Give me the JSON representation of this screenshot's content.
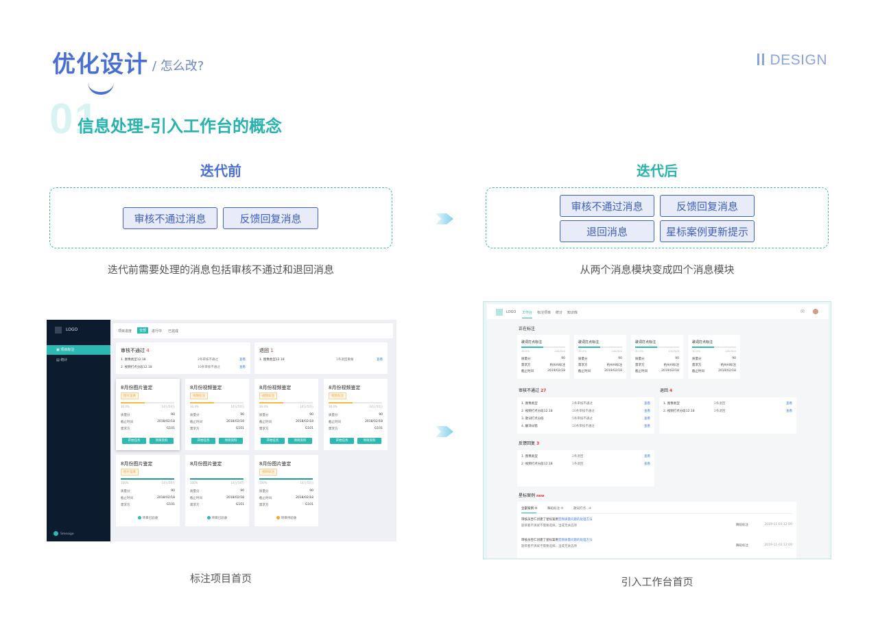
{
  "header": {
    "title": "优化设计",
    "subtitle": "/ 怎么改?",
    "brand": "DESIGN",
    "section_number": "01",
    "section_title": "信息处理-引入工作台的概念"
  },
  "before": {
    "label": "迭代前",
    "buttons": [
      "审核不通过消息",
      "反馈回复消息"
    ],
    "caption": "迭代前需要处理的消息包括审核不通过和退回消息",
    "screenshot_caption": "标注项目首页"
  },
  "after": {
    "label": "迭代后",
    "buttons": [
      "审核不通过消息",
      "反馈回复消息",
      "退回消息",
      "星标案例更新提示"
    ],
    "caption": "从两个消息模块变成四个消息模块",
    "screenshot_caption": "引入工作台首页"
  },
  "shotA": {
    "logo": "LOGO",
    "nav": [
      "项目标注",
      "统计"
    ],
    "user": "Smeaige",
    "tabs": [
      "项目进度",
      "全部",
      "进行中",
      "已完成"
    ],
    "reject_box": {
      "title": "审核不通过",
      "count": "4",
      "rows": [
        {
          "name": "1. 图像类型12.18",
          "msg": "2条审核不通过",
          "action": "查看"
        },
        {
          "name": "2. 视频打点分段12.18",
          "msg": "10条审核不通过",
          "action": "查看"
        }
      ]
    },
    "return_box": {
      "title": "退回",
      "count": "1",
      "rows": [
        {
          "name": "1. 图像类型12.18",
          "msg": "1条退回重做",
          "action": "查看"
        }
      ]
    },
    "cards": [
      {
        "title": "8月份图片鉴定",
        "tag": "图片鉴黄",
        "pct": "30.4%",
        "pcr": "14万/50万",
        "progress": 0.45,
        "q": "90",
        "d": "2018/02/18",
        "r": "G101",
        "state": "buttons"
      },
      {
        "title": "8月份视频鉴定",
        "tag": "视频标注",
        "pct": "30.4%",
        "pcr": "14万/50万",
        "progress": 0.45,
        "q": "90",
        "d": "2018/02/18",
        "r": "G101",
        "state": "buttons"
      },
      {
        "title": "8月份视频鉴定",
        "tag": "视频标注",
        "pct": "30.4%",
        "pcr": "14万/50万",
        "progress": 0.45,
        "q": "90",
        "d": "2018/02/18",
        "r": "G101",
        "state": "buttons"
      },
      {
        "title": "8月份视频鉴定",
        "tag": "视频标注",
        "pct": "30.4%",
        "pcr": "14万/50万",
        "progress": 0.45,
        "q": "90",
        "d": "2018/02/18",
        "r": "G101",
        "state": "buttons"
      },
      {
        "title": "8月份图片鉴定",
        "tag": "图片鉴黄",
        "pct": "100%",
        "pcr": "14万/50万",
        "progress": 1,
        "q": "90",
        "d": "2018/02/18",
        "r": "G101",
        "state": "项目已验收"
      },
      {
        "title": "8月份图片鉴定",
        "tag": "",
        "pct": "100%",
        "pcr": "14万/50万",
        "progress": 1,
        "q": "90",
        "d": "2018/02/18",
        "r": "G101",
        "state": "项目已验收"
      },
      {
        "title": "8月份图片鉴定",
        "tag": "视频标注",
        "pct": "100%",
        "pcr": "14万/50万",
        "progress": 1,
        "q": "90",
        "d": "2018/02/18",
        "r": "G101",
        "state": "项目待验收"
      }
    ],
    "labels": {
      "q": "质量分",
      "d": "截止时间",
      "r": "需求方",
      "start": "开始任务",
      "data": "项目资料"
    }
  },
  "shotB": {
    "logo": "LOGO",
    "tabs": [
      "工作台",
      "标注项目",
      "统计",
      "知识库"
    ],
    "in_progress": {
      "title": "正在标注",
      "cards": [
        {
          "title": "歌词打点标注",
          "pct": "30.5%",
          "pcr": "100/500",
          "q": "90",
          "r": "杭州AI标注",
          "d": "2019/02/18"
        },
        {
          "title": "歌词打点标注",
          "pct": "30.5%",
          "pcr": "100/500",
          "q": "90",
          "r": "杭州AI标注",
          "d": "2019/02/18"
        },
        {
          "title": "歌词打点标注",
          "pct": "30.5%",
          "pcr": "100/500",
          "q": "90",
          "r": "杭州AI标注",
          "d": "2019/02/18"
        },
        {
          "title": "歌词打点标注",
          "pct": "30.5%",
          "pcr": "100/500",
          "q": "90",
          "r": "杭州AI标注",
          "d": "2019/02/18"
        }
      ]
    },
    "labels": {
      "q": "质量分",
      "r": "需求方",
      "d": "截止时间"
    },
    "reject": {
      "title": "审核不通过",
      "count": "27",
      "rows": [
        {
          "name": "1. 图像类型",
          "msg": "2条审核不通过",
          "action": "查看"
        },
        {
          "name": "2. 视频打点分段12.18",
          "msg": "10条审核不通过",
          "action": "查看"
        },
        {
          "name": "3. 歌词打点分段",
          "msg": "5条审核不通过",
          "action": "查看"
        },
        {
          "name": "4. 翻译纠错",
          "msg": "10条审核不通过",
          "action": "查看"
        }
      ]
    },
    "returned": {
      "title": "退回",
      "count": "4",
      "rows": [
        {
          "name": "1. 图像类型",
          "msg": "2条退回",
          "action": "查看"
        },
        {
          "name": "2. 视频打点分段12.18",
          "msg": "2条退回",
          "action": "查看"
        }
      ]
    },
    "feedback": {
      "title": "反馈回复",
      "count": "3",
      "rows": [
        {
          "name": "1. 图像类型",
          "msg": "2条退回",
          "action": "查看"
        },
        {
          "name": "2. 视频打点分段12.18",
          "msg": "1条退回",
          "action": "查看"
        }
      ]
    },
    "star": {
      "title": "星标案例",
      "badge": "new",
      "tabs": [
        "全部案例 ⑩",
        "舞蹈标注 ⑩",
        "歌词打点...④"
      ],
      "items": [
        {
          "line1": "审核员杏仁创建了星标案例",
          "link": "音频质量问题的处理方法",
          "line2": "题目看不清就不需要选择，当成无关选项",
          "tag": "舞蹈标注",
          "time": "2019-11-03 12:00"
        },
        {
          "line1": "审核员杏仁创建了星标案例",
          "link": "音频质量问题的处理方法",
          "line2": "题目看不清就不需要选择，当成无关选项",
          "tag": "舞蹈标注",
          "time": "2019-11-03 12:00"
        }
      ]
    }
  }
}
